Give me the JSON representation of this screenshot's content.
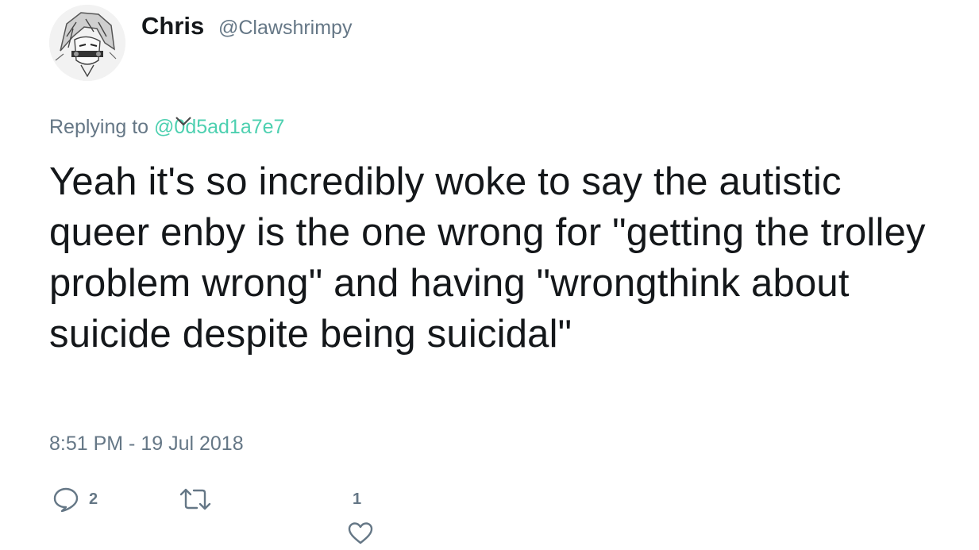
{
  "author": {
    "display_name": "Chris",
    "handle": "@Clawshrimpy"
  },
  "reply": {
    "prefix": "Replying to",
    "to_handle": "@0d5ad1a7e7"
  },
  "tweet": {
    "text": "Yeah it's so incredibly woke to say the autistic queer enby is the one wrong for \"getting the trolley problem wrong\" and having \"wrongthink about suicide despite being suicidal\"",
    "timestamp": "8:51 PM - 19 Jul 2018"
  },
  "actions": {
    "replies": "2",
    "likes": "1",
    "reply_icon": "reply-bubble-icon",
    "retweet_icon": "retweet-icon",
    "like_icon": "heart-icon"
  },
  "colors": {
    "text": "#14171a",
    "muted": "#657786",
    "mention": "#4dd0b0"
  }
}
